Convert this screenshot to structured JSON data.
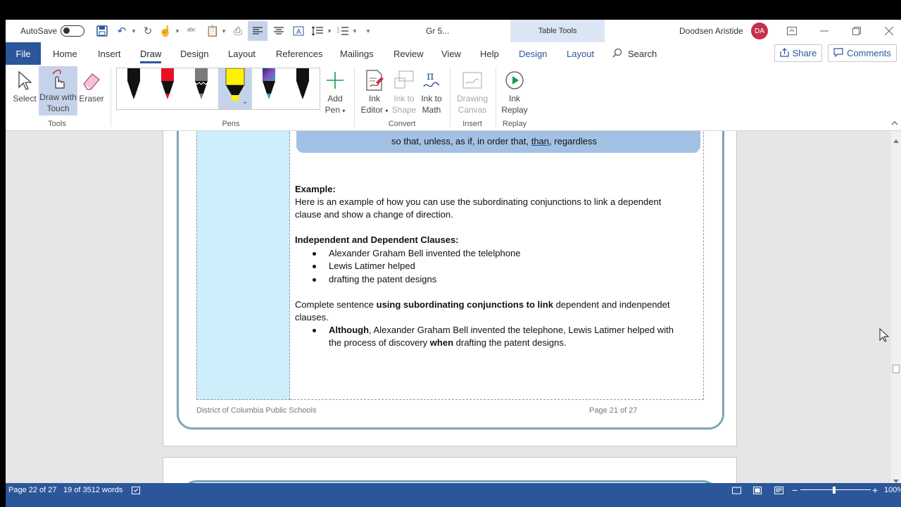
{
  "titlebar": {
    "autosave_label": "AutoSave",
    "doc_title": "Gr 5...",
    "context_tab": "Table Tools",
    "user_name": "Doodsen Aristide",
    "user_initials": "DA"
  },
  "tabs": [
    "File",
    "Home",
    "Insert",
    "Draw",
    "Design",
    "Layout",
    "References",
    "Mailings",
    "Review",
    "View",
    "Help",
    "Design",
    "Layout"
  ],
  "active_tab": "Draw",
  "search_label": "Search",
  "share_label": "Share",
  "comments_label": "Comments",
  "ribbon": {
    "tools": {
      "select": "Select",
      "draw_touch_1": "Draw with",
      "draw_touch_2": "Touch",
      "eraser": "Eraser",
      "group": "Tools"
    },
    "pens_group": "Pens",
    "add_pen_1": "Add",
    "add_pen_2": "Pen",
    "convert": {
      "ink_editor_1": "Ink",
      "ink_editor_2": "Editor",
      "ink_shape_1": "Ink to",
      "ink_shape_2": "Shape",
      "ink_math_1": "Ink to",
      "ink_math_2": "Math",
      "group": "Convert"
    },
    "insert": {
      "canvas_1": "Drawing",
      "canvas_2": "Canvas",
      "group": "Insert"
    },
    "replay": {
      "label_1": "Ink",
      "label_2": "Replay",
      "group": "Replay"
    },
    "pens": [
      {
        "name": "black-pen",
        "color": "#000000"
      },
      {
        "name": "red-pen",
        "color": "#e81123"
      },
      {
        "name": "pencil",
        "color": "#7a7a7a"
      },
      {
        "name": "yellow-highlighter",
        "color": "#fff200"
      },
      {
        "name": "galaxy-pen",
        "color": "#3b3a8c"
      },
      {
        "name": "black-pen-2",
        "color": "#000000"
      }
    ]
  },
  "document": {
    "conj_line_pre": "so that, unless, as if, in order that, ",
    "conj_line_than": "than",
    "conj_line_post": ", regardless",
    "example_heading": "Example:",
    "example_line1": "Here is an example of how you can use the subordinating conjunctions to link a dependent",
    "example_line2": "clause and show a change of direction.",
    "clauses_heading": "Independent and Dependent Clauses:",
    "bullets": [
      "Alexander Graham Bell invented the telelphone",
      "Lewis Latimer helped",
      "drafting the patent designs"
    ],
    "complete_pre": "Complete sentence ",
    "complete_bold": "using subordinating conjunctions to link",
    "complete_post": " dependent and indenpendet",
    "complete_line2": "clauses.",
    "answer_bold1": "Although",
    "answer_text1": ", Alexander Graham Bell invented the telephone, Lewis Latimer helped with",
    "answer_text2a": "the process of discovery ",
    "answer_bold2": "when",
    "answer_text2b": " drafting the patent designs.",
    "footer_left": "District of Columbia Public Schools",
    "footer_right": "Page 21 of 27"
  },
  "status": {
    "page": "Page 22 of 27",
    "words": "19 of 3512 words",
    "zoom": "100%"
  },
  "colors": {
    "brand": "#2b579a",
    "accent_blue_box": "#a3c1e5",
    "frame": "#7ea6b8",
    "left_cell": "#cdeefa"
  }
}
